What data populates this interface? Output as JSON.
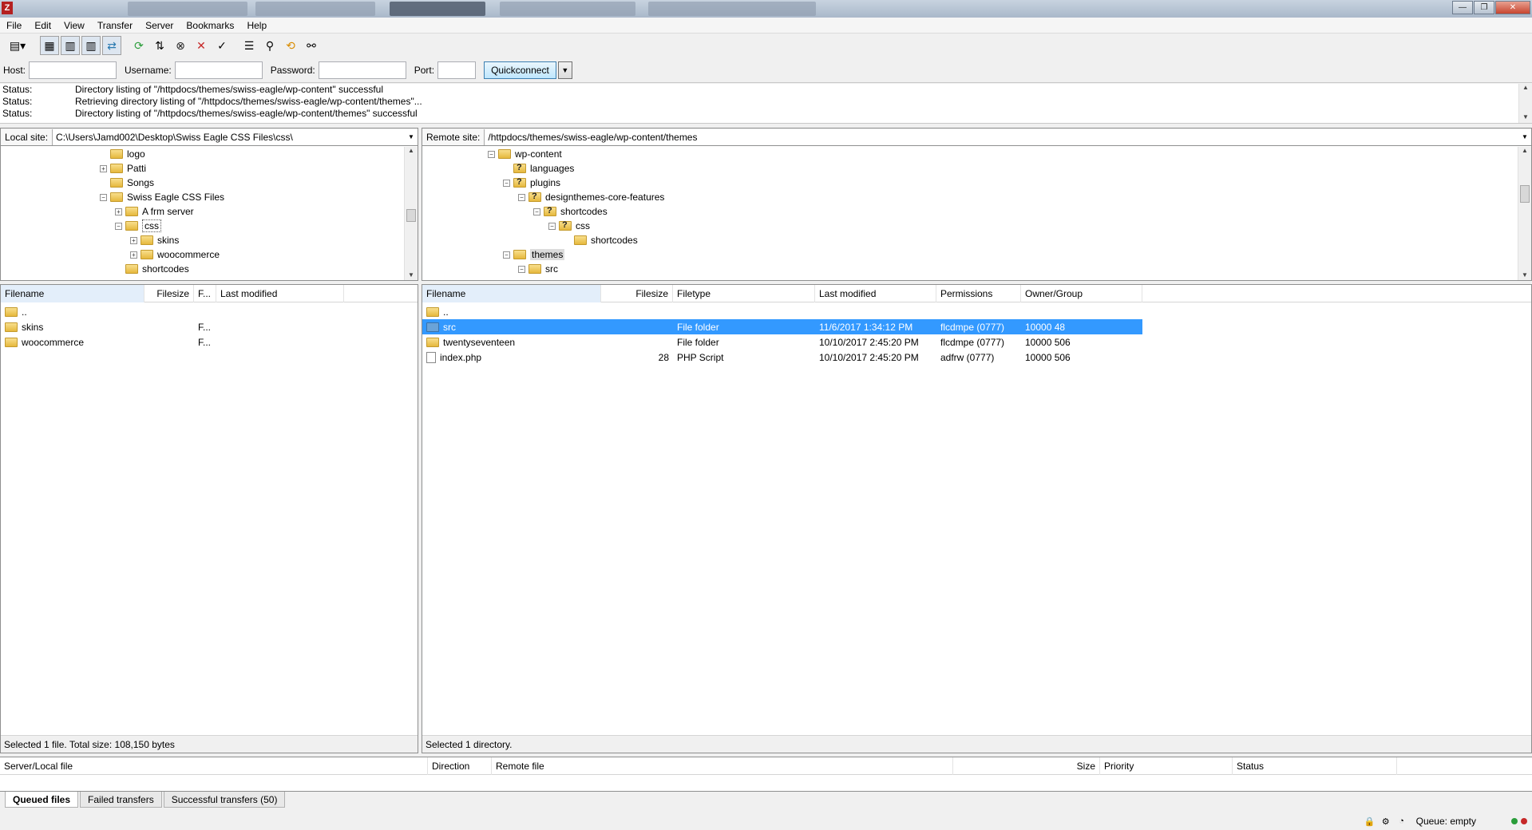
{
  "window": {
    "app_icon": "filezilla-icon",
    "buttons": {
      "minimize": "—",
      "maximize": "❐",
      "close": "✕"
    }
  },
  "menu": [
    "File",
    "Edit",
    "View",
    "Transfer",
    "Server",
    "Bookmarks",
    "Help"
  ],
  "toolbar": {
    "icons": [
      "site-manager-icon",
      "toggle-log-icon",
      "toggle-local-tree-icon",
      "toggle-remote-tree-icon",
      "toggle-queue-icon",
      "refresh-icon",
      "process-queue-icon",
      "cancel-icon",
      "disconnect-icon",
      "reconnect-icon",
      "filter-icon",
      "compare-icon",
      "sync-browse-icon",
      "search-icon"
    ]
  },
  "quickconnect": {
    "host_label": "Host:",
    "username_label": "Username:",
    "password_label": "Password:",
    "port_label": "Port:",
    "host_value": "",
    "username_value": "",
    "password_value": "",
    "port_value": "",
    "button_label": "Quickconnect",
    "dropdown_glyph": "▼"
  },
  "log": [
    {
      "tag": "Status:",
      "message": "Directory listing of \"/httpdocs/themes/swiss-eagle/wp-content\" successful"
    },
    {
      "tag": "Status:",
      "message": "Retrieving directory listing of \"/httpdocs/themes/swiss-eagle/wp-content/themes\"..."
    },
    {
      "tag": "Status:",
      "message": "Directory listing of \"/httpdocs/themes/swiss-eagle/wp-content/themes\" successful"
    }
  ],
  "local": {
    "site_label": "Local site:",
    "path": "C:\\Users\\Jamd002\\Desktop\\Swiss Eagle CSS Files\\css\\",
    "tree": [
      {
        "label": "logo",
        "expander": ""
      },
      {
        "label": "Patti",
        "expander": "+"
      },
      {
        "label": "Songs",
        "expander": ""
      },
      {
        "label": "Swiss Eagle CSS Files",
        "expander": "−"
      },
      {
        "label": "A frm server",
        "expander": "+"
      },
      {
        "label": "css",
        "expander": "−"
      },
      {
        "label": "skins",
        "expander": "+"
      },
      {
        "label": "woocommerce",
        "expander": "+"
      },
      {
        "label": "shortcodes",
        "expander": ""
      }
    ],
    "columns": [
      "Filename",
      "Filesize",
      "F...",
      "Last modified"
    ],
    "rows": [
      {
        "name": "..",
        "size": "",
        "type": "",
        "modified": ""
      },
      {
        "name": "skins",
        "size": "",
        "type": "F...",
        "modified": ""
      },
      {
        "name": "woocommerce",
        "size": "",
        "type": "F...",
        "modified": ""
      }
    ],
    "status": "Selected 1 file. Total size: 108,150 bytes"
  },
  "remote": {
    "site_label": "Remote site:",
    "path": "/httpdocs/themes/swiss-eagle/wp-content/themes",
    "tree": [
      {
        "label": "wp-content",
        "expander": "−",
        "q": false
      },
      {
        "label": "languages",
        "expander": "",
        "q": true
      },
      {
        "label": "plugins",
        "expander": "−",
        "q": true
      },
      {
        "label": "designthemes-core-features",
        "expander": "−",
        "q": true
      },
      {
        "label": "shortcodes",
        "expander": "−",
        "q": true
      },
      {
        "label": "css",
        "expander": "−",
        "q": true
      },
      {
        "label": "shortcodes",
        "expander": "",
        "q": false
      },
      {
        "label": "themes",
        "expander": "−",
        "q": false
      },
      {
        "label": "src",
        "expander": "−",
        "q": false
      }
    ],
    "columns": [
      "Filename",
      "Filesize",
      "Filetype",
      "Last modified",
      "Permissions",
      "Owner/Group"
    ],
    "rows": [
      {
        "name": "..",
        "size": "",
        "type": "",
        "modified": "",
        "perms": "",
        "owner": "",
        "icon": "folder",
        "selected": false
      },
      {
        "name": "src",
        "size": "",
        "type": "File folder",
        "modified": "11/6/2017 1:34:12 PM",
        "perms": "flcdmpe (0777)",
        "owner": "10000 48",
        "icon": "folder",
        "selected": true
      },
      {
        "name": "twentyseventeen",
        "size": "",
        "type": "File folder",
        "modified": "10/10/2017 2:45:20 PM",
        "perms": "flcdmpe (0777)",
        "owner": "10000 506",
        "icon": "folder",
        "selected": false
      },
      {
        "name": "index.php",
        "size": "28",
        "type": "PHP Script",
        "modified": "10/10/2017 2:45:20 PM",
        "perms": "adfrw (0777)",
        "owner": "10000 506",
        "icon": "file",
        "selected": false
      }
    ],
    "status": "Selected 1 directory."
  },
  "queue": {
    "columns": [
      "Server/Local file",
      "Direction",
      "Remote file",
      "Size",
      "Priority",
      "Status"
    ]
  },
  "tabs": [
    "Queued files",
    "Failed transfers",
    "Successful transfers (50)"
  ],
  "statusbar": {
    "icons": [
      "lock-icon",
      "gear-icon",
      "speed-limit-icon"
    ],
    "queue_text": "Queue: empty",
    "indicator_colors": [
      "#2a9d3a",
      "#c62828"
    ]
  }
}
